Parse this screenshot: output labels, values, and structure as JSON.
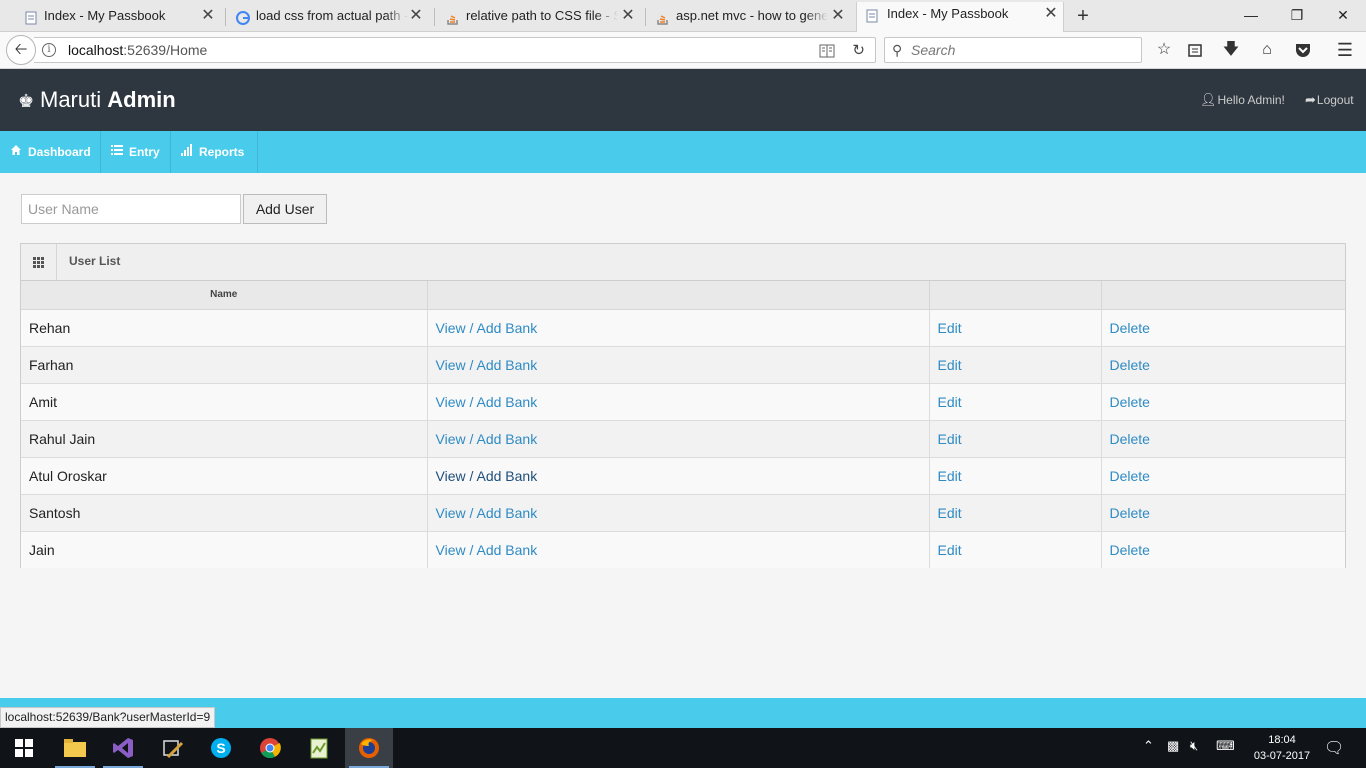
{
  "browser": {
    "tabs": [
      {
        "title": "Index - My Passbook",
        "icon": "page-icon",
        "active": false
      },
      {
        "title": "load css from actual path - G",
        "icon": "google-icon",
        "active": false
      },
      {
        "title": "relative path to CSS file - Sta",
        "icon": "stackoverflow-icon",
        "active": false
      },
      {
        "title": "asp.net mvc - how to genera",
        "icon": "stackoverflow-icon",
        "active": false
      },
      {
        "title": "Index - My Passbook",
        "icon": "page-icon",
        "active": true
      }
    ],
    "url_host": "localhost",
    "url_rest": ":52639/Home",
    "search_placeholder": "Search"
  },
  "header": {
    "brand_light": "Maruti",
    "brand_bold": "Admin",
    "hello": "Hello Admin!",
    "logout": "Logout"
  },
  "menu": {
    "items": [
      {
        "label": "Dashboard",
        "icon": "home-icon"
      },
      {
        "label": "Entry",
        "icon": "list-icon"
      },
      {
        "label": "Reports",
        "icon": "bar-chart-icon"
      }
    ]
  },
  "form": {
    "user_name_placeholder": "User Name",
    "add_user_label": "Add User"
  },
  "user_list": {
    "title": "User List",
    "columns": [
      "Name",
      "",
      "",
      ""
    ],
    "rows": [
      {
        "name": "Rehan",
        "view": "View / Add Bank",
        "edit": "Edit",
        "delete": "Delete"
      },
      {
        "name": "Farhan",
        "view": "View / Add Bank",
        "edit": "Edit",
        "delete": "Delete"
      },
      {
        "name": "Amit",
        "view": "View / Add Bank",
        "edit": "Edit",
        "delete": "Delete"
      },
      {
        "name": "Rahul Jain",
        "view": "View / Add Bank",
        "edit": "Edit",
        "delete": "Delete"
      },
      {
        "name": "Atul Oroskar",
        "view": "View / Add Bank",
        "edit": "Edit",
        "delete": "Delete"
      },
      {
        "name": "Santosh",
        "view": "View / Add Bank",
        "edit": "Edit",
        "delete": "Delete"
      },
      {
        "name": "Jain",
        "view": "View / Add Bank",
        "edit": "Edit",
        "delete": "Delete"
      }
    ]
  },
  "status_bar": {
    "link_preview": "localhost:52639/Bank?userMasterId=9"
  },
  "taskbar": {
    "time": "18:04",
    "date": "03-07-2017"
  },
  "colors": {
    "header_bg": "#2e363f",
    "menu_bg": "#49cceb",
    "link": "#2f8bc4"
  }
}
